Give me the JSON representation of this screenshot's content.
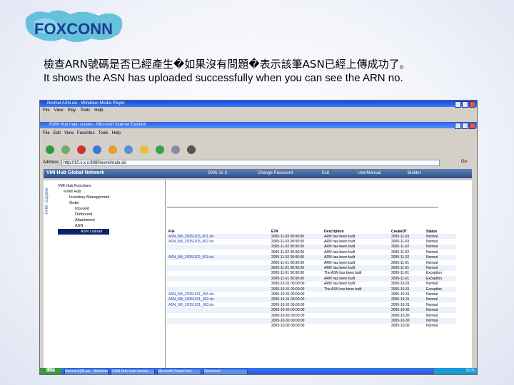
{
  "logo": {
    "text": "FOXCONN"
  },
  "caption": {
    "zh": "檢查ARN號碼是否已經產生�如果沒有問題�表示該筆ASN已經上傳成功了。",
    "en": "It shows the ASN has uploaded successfully when you can see the ARN no."
  },
  "media_player": {
    "title": "Normal ASN.avi - Windows Media Player"
  },
  "browser": {
    "title": "XVMI Hub main screen - Microsoft Internet Explorer",
    "address": "http://10.x.x.x:8080/xvmi/main.do"
  },
  "app_header": {
    "site": "VMI Hub Global Network",
    "date": "2005-11-3",
    "items": [
      "Change Password",
      "Exit",
      "UserManual",
      "Builder"
    ]
  },
  "sidebar": {
    "vertical_tab": "eVMI Supplier",
    "tree": [
      "VMI Hub Functions",
      "eVMI Hub",
      "Inventory Management",
      "Order",
      "Inbound",
      "Outbound",
      "Attachment",
      "ASN",
      "ASN Upload"
    ]
  },
  "table": {
    "headers": [
      "File",
      "ETA",
      "Description",
      "CreateDT",
      "Status"
    ],
    "rows": [
      [
        "ASN_NB_20051103_001.xls",
        "2005-11-03 00:00:00",
        "ARN has been built",
        "2005-11-03",
        "Normal"
      ],
      [
        "ASN_NB_20051103_002.xls",
        "2005-11-03 00:00:00",
        "ARN has been built",
        "2005-11-03",
        "Normal"
      ],
      [
        "",
        "2005-11-02 00:00:00",
        "ARN has been built",
        "2005-11-02",
        "Normal"
      ],
      [
        "",
        "2005-11-02 00:00:00",
        "ARN has been built",
        "2005-11-02",
        "Normal"
      ],
      [
        "ASN_NB_20051102_003.xls",
        "2005-11-02 00:00:00",
        "ARN has been built",
        "2005-11-02",
        "Normal"
      ],
      [
        "",
        "2005-11-01 00:00:00",
        "ARN has been built",
        "2005-11-01",
        "Normal"
      ],
      [
        "",
        "2005-11-01 00:00:00",
        "ARN has been built",
        "2005-11-01",
        "Normal"
      ],
      [
        "",
        "2005-11-01 00:00:00",
        "The ASN has been built",
        "2005-11-01",
        "Exception"
      ],
      [
        "",
        "2005-11-01 00:00:00",
        "ARN has been built",
        "2005-11-01",
        "Exception"
      ],
      [
        "",
        "2005-10-31 00:00:00",
        "ARN has been built",
        "2005-10-31",
        "Normal"
      ],
      [
        "",
        "2005-10-31 00:00:00",
        "The ASN has been built",
        "2005-10-31",
        "Exception"
      ],
      [
        "ASN_NB_20051031_001.xls",
        "2005-10-31 00:00:00",
        "",
        "2005-10-31",
        "Normal"
      ],
      [
        "ASN_NB_20051031_002.xls",
        "2005-10-31 00:00:00",
        "",
        "2005-10-31",
        "Normal"
      ],
      [
        "ASN_NB_20051031_003.xls",
        "2005-10-31 00:00:00",
        "",
        "2005-10-31",
        "Normal"
      ],
      [
        "",
        "2005-10-30 00:00:00",
        "",
        "2005-10-30",
        "Normal"
      ],
      [
        "",
        "2005-10-30 00:00:00",
        "",
        "2005-10-30",
        "Normal"
      ],
      [
        "",
        "2005-10-30 00:00:00",
        "",
        "2005-10-30",
        "Normal"
      ],
      [
        "",
        "2005-10-30 00:00:00",
        "",
        "2005-10-30",
        "Normal"
      ]
    ]
  },
  "taskbar": {
    "start": "開始",
    "tasks": [
      "Normal ASN.avi - Windows...",
      "XVMI Hub main screen - ...",
      "Microsoft PowerPoint",
      "Document"
    ],
    "clock": "15:35"
  }
}
